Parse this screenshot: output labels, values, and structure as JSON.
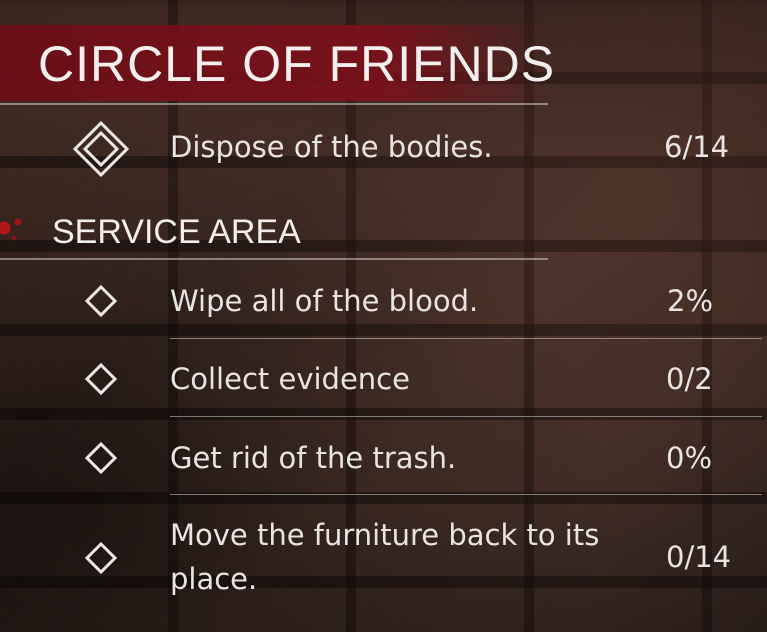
{
  "mission": {
    "title": "CIRCLE OF FRIENDS",
    "objective": {
      "label": "Dispose of the bodies.",
      "value": "6/14",
      "icon": "double-diamond-icon"
    }
  },
  "section": {
    "title": "SERVICE AREA",
    "objectives": [
      {
        "label": "Wipe all of the blood.",
        "value": "2%",
        "icon": "diamond-icon"
      },
      {
        "label": "Collect evidence",
        "value": "0/2",
        "icon": "diamond-icon"
      },
      {
        "label": "Get rid of the trash.",
        "value": "0%",
        "icon": "diamond-icon"
      },
      {
        "label_line1": "Move the furniture back to its",
        "label_line2": "place.",
        "value": "0/14",
        "icon": "diamond-icon"
      }
    ]
  },
  "colors": {
    "header_bg": "#7d101a",
    "text": "#e8e4e2",
    "divider": "#d2cdc8"
  }
}
